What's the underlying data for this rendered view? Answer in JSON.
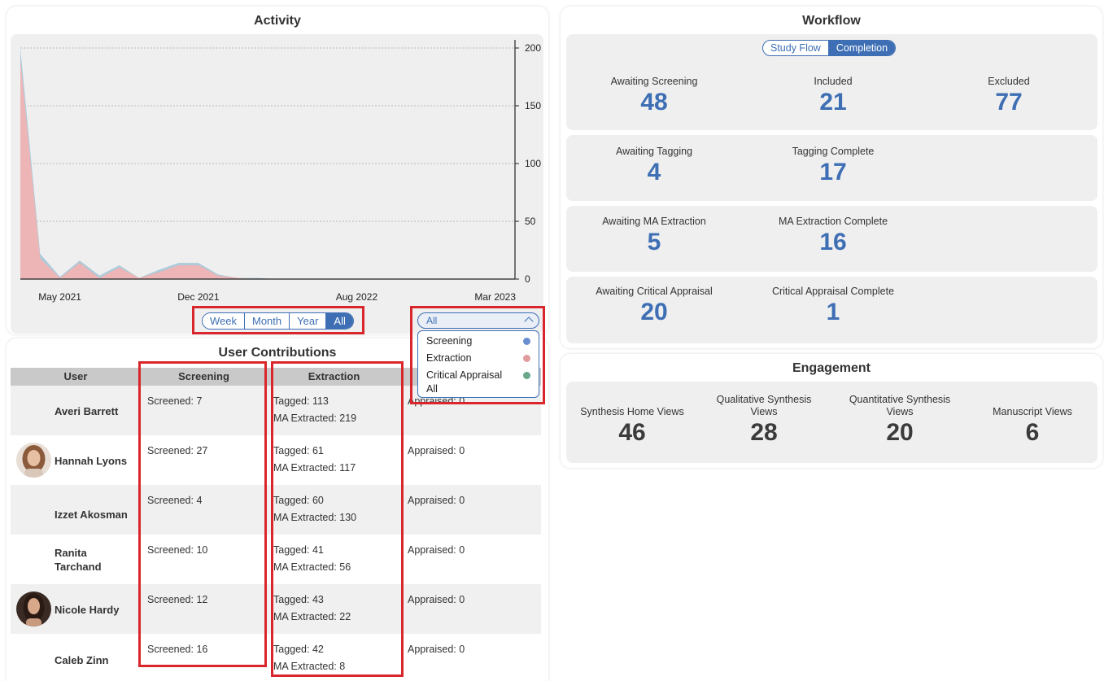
{
  "activity": {
    "title": "Activity",
    "chart_data": {
      "type": "area",
      "x": [
        "Mar 2021",
        "Apr 2021",
        "May 2021",
        "Jun 2021",
        "Jul 2021",
        "Aug 2021",
        "Sep 2021",
        "Oct 2021",
        "Nov 2021",
        "Dec 2021",
        "Jan 2022",
        "Feb 2022",
        "Mar 2022",
        "Apr 2022",
        "May 2022",
        "Jun 2022",
        "Jul 2022",
        "Aug 2022",
        "Sep 2022",
        "Oct 2022",
        "Nov 2022",
        "Dec 2022",
        "Jan 2023",
        "Feb 2023",
        "Mar 2023",
        "Apr 2023"
      ],
      "series": [
        {
          "name": "Screening",
          "color": "#6a8fd0",
          "values": [
            200,
            22,
            2,
            16,
            3,
            12,
            1,
            8,
            14,
            14,
            4,
            1,
            1,
            0,
            0,
            0,
            0,
            0,
            0,
            0,
            0,
            0,
            0,
            0,
            0,
            0
          ]
        },
        {
          "name": "Extraction",
          "color": "#e09c9e",
          "values": [
            190,
            18,
            1,
            14,
            1,
            10,
            1,
            6,
            12,
            12,
            3,
            1,
            0,
            0,
            0,
            0,
            0,
            0,
            0,
            0,
            0,
            0,
            0,
            0,
            0,
            0
          ]
        },
        {
          "name": "Critical Appraisal",
          "color": "#6aa88c",
          "values": [
            0,
            0,
            0,
            0,
            0,
            0,
            0,
            0,
            0,
            0,
            0,
            0,
            0,
            0,
            0,
            0,
            0,
            0,
            0,
            0,
            0,
            0,
            0,
            0,
            0,
            0
          ]
        }
      ],
      "x_tick_labels": [
        "May 2021",
        "Dec 2021",
        "Aug 2022",
        "Mar 2023"
      ],
      "y_ticks": [
        0,
        50,
        100,
        150,
        200
      ],
      "ylim": [
        0,
        200
      ],
      "grid": true,
      "y_axis_side": "right"
    },
    "range_options": [
      "Week",
      "Month",
      "Year",
      "All"
    ],
    "range_selected": "All",
    "series_filter": {
      "selected": "All",
      "options": [
        {
          "label": "Screening",
          "color": "#6a8fd0"
        },
        {
          "label": "Extraction",
          "color": "#e09c9e"
        },
        {
          "label": "Critical Appraisal",
          "color": "#6aa88c"
        },
        {
          "label": "All"
        }
      ]
    }
  },
  "contributions": {
    "title": "User Contributions",
    "headers": [
      "User",
      "Screening",
      "Extraction",
      ""
    ],
    "rows": [
      {
        "user": "Averi Barrett",
        "screening": "Screened: 7",
        "tagged": "Tagged: 113",
        "extracted": "MA Extracted: 219",
        "appraised": "Appraised: 0",
        "avatar": false
      },
      {
        "user": "Hannah Lyons",
        "screening": "Screened: 27",
        "tagged": "Tagged: 61",
        "extracted": "MA Extracted: 117",
        "appraised": "Appraised: 0",
        "avatar": true
      },
      {
        "user": "Izzet Akosman",
        "screening": "Screened: 4",
        "tagged": "Tagged: 60",
        "extracted": "MA Extracted: 130",
        "appraised": "Appraised: 0",
        "avatar": false
      },
      {
        "user": "Ranita Tarchand",
        "screening": "Screened: 10",
        "tagged": "Tagged: 41",
        "extracted": "MA Extracted: 56",
        "appraised": "Appraised: 0",
        "avatar": false
      },
      {
        "user": "Nicole Hardy",
        "screening": "Screened: 12",
        "tagged": "Tagged: 43",
        "extracted": "MA Extracted: 22",
        "appraised": "Appraised: 0",
        "avatar": true
      },
      {
        "user": "Caleb Zinn",
        "screening": "Screened: 16",
        "tagged": "Tagged: 42",
        "extracted": "MA Extracted: 8",
        "appraised": "Appraised: 0",
        "avatar": false
      }
    ]
  },
  "workflow": {
    "title": "Workflow",
    "toggle": [
      "Study Flow",
      "Completion"
    ],
    "toggle_selected": "Completion",
    "metrics": {
      "awaiting_screening": {
        "label": "Awaiting Screening",
        "value": "48"
      },
      "included": {
        "label": "Included",
        "value": "21"
      },
      "excluded": {
        "label": "Excluded",
        "value": "77"
      },
      "awaiting_tagging": {
        "label": "Awaiting Tagging",
        "value": "4"
      },
      "tagging_complete": {
        "label": "Tagging Complete",
        "value": "17"
      },
      "awaiting_ma": {
        "label": "Awaiting MA Extraction",
        "value": "5"
      },
      "ma_complete": {
        "label": "MA Extraction Complete",
        "value": "16"
      },
      "awaiting_ca": {
        "label": "Awaiting Critical Appraisal",
        "value": "20"
      },
      "ca_complete": {
        "label": "Critical Appraisal Complete",
        "value": "1"
      }
    }
  },
  "engagement": {
    "title": "Engagement",
    "metrics": {
      "synthesis_home": {
        "label_1": "Synthesis Home Views",
        "label_2": "",
        "value": "46"
      },
      "qualitative": {
        "label_1": "Qualitative Synthesis",
        "label_2": "Views",
        "value": "28"
      },
      "quantitative": {
        "label_1": "Quantitative Synthesis",
        "label_2": "Views",
        "value": "20"
      },
      "manuscript": {
        "label_1": "Manuscript Views",
        "label_2": "",
        "value": "6"
      }
    }
  }
}
